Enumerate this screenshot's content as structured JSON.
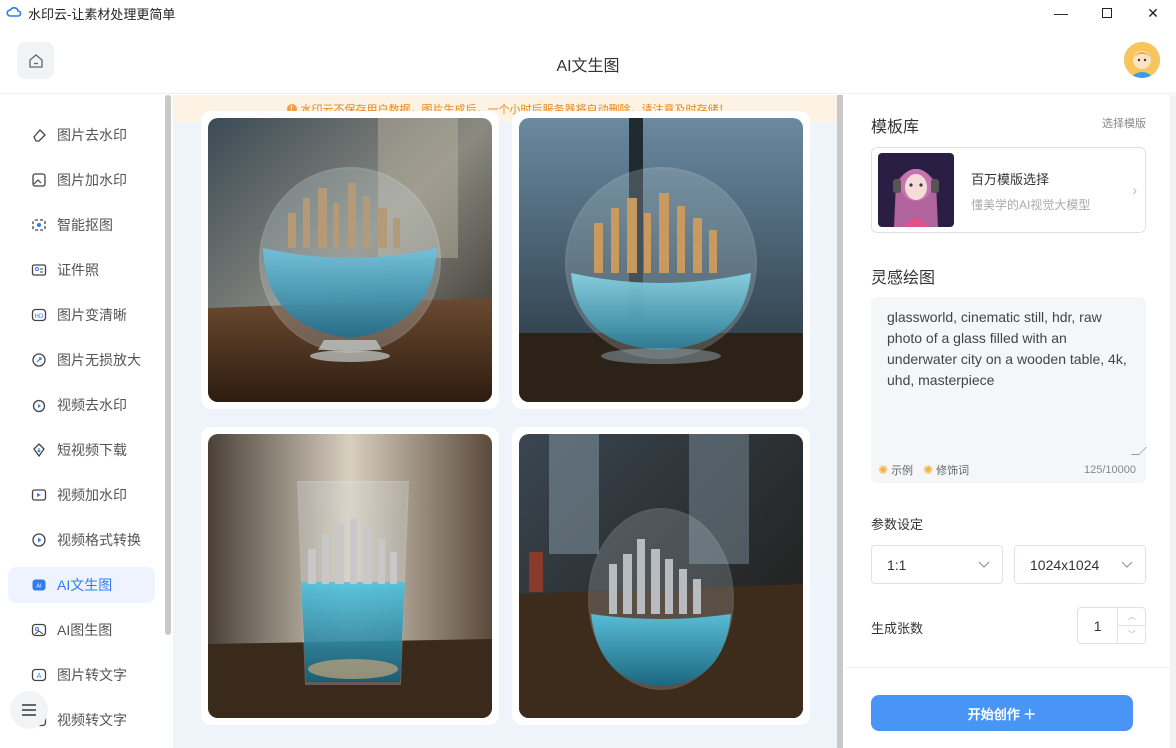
{
  "window": {
    "title": "水印云-让素材处理更简单",
    "minimize": "—",
    "maximize": "☐",
    "close": "✕"
  },
  "header": {
    "title": "AI文生图"
  },
  "sidebar": {
    "items": [
      {
        "label": "图片去水印",
        "icon": "eraser-icon"
      },
      {
        "label": "图片加水印",
        "icon": "image-add-icon"
      },
      {
        "label": "智能抠图",
        "icon": "cutout-icon"
      },
      {
        "label": "证件照",
        "icon": "id-card-icon"
      },
      {
        "label": "图片变清晰",
        "icon": "hd-icon"
      },
      {
        "label": "图片无损放大",
        "icon": "enlarge-icon"
      },
      {
        "label": "视频去水印",
        "icon": "video-eraser-icon"
      },
      {
        "label": "短视频下载",
        "icon": "download-icon"
      },
      {
        "label": "视频加水印",
        "icon": "video-add-icon"
      },
      {
        "label": "视频格式转换",
        "icon": "play-circle-icon"
      },
      {
        "label": "AI文生图",
        "icon": "ai-text-image-icon",
        "active": true
      },
      {
        "label": "AI图生图",
        "icon": "ai-image-image-icon"
      },
      {
        "label": "图片转文字",
        "icon": "ocr-icon"
      },
      {
        "label": "视频转文字",
        "icon": "video-text-icon"
      }
    ]
  },
  "notice": {
    "text": "水印云不保存用户数据，图片生成后，一个小时后服务器将自动删除，请注意及时存储！"
  },
  "gallery": {
    "images": [
      {
        "alt": "glass bowl with underwater city 1"
      },
      {
        "alt": "glass bowl with underwater city 2"
      },
      {
        "alt": "glass with underwater city 3"
      },
      {
        "alt": "glass with underwater city 4"
      }
    ]
  },
  "templates": {
    "title": "模板库",
    "select_link": "选择模版",
    "card_name": "百万模版选择",
    "card_desc": "懂美学的AI视觉大模型"
  },
  "prompt": {
    "title": "灵感绘图",
    "text": "glassworld, cinematic still, hdr, raw photo of a glass filled with an underwater city on a wooden table, 4k, uhd, masterpiece",
    "example": "示例",
    "modifier": "修饰词",
    "count": "125/10000"
  },
  "params": {
    "title": "参数设定",
    "ratio": "1:1",
    "size": "1024x1024",
    "count_label": "生成张数",
    "count_value": "1"
  },
  "action": {
    "start": "开始创作 ＋"
  },
  "colors": {
    "accent": "#2f7cf0",
    "button": "#4895f6",
    "notice_bg": "#fdf3e4",
    "notice_text": "#e8871e",
    "main_bg": "#eff3fa"
  }
}
